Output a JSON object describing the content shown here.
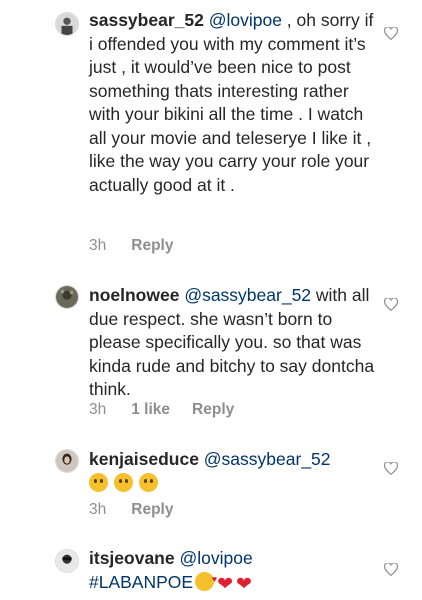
{
  "comments": [
    {
      "username": "sassybear_52",
      "mention": "@lovipoe",
      "text": " , oh sorry if i offended you with my comment it’s just , it would’ve been nice to post something thats interesting rather  with your bikini all the time . I watch all your movie and teleserye I like it , like the way you carry your role your actually good at it .",
      "time": "3h",
      "reply": "Reply"
    },
    {
      "username": "noelnowee",
      "mention": "@sassybear_52",
      "text": " with all due respect. she wasn’t born to please specifically you. so that was kinda rude and bitchy to say dontcha think.",
      "time": "3h",
      "likes": "1 like",
      "reply": "Reply"
    },
    {
      "username": "kenjaiseduce",
      "mention": "@sassybear_52",
      "emoji": "thinking-face x3",
      "time": "3h",
      "reply": "Reply"
    },
    {
      "username": "itsjeovane",
      "mention": "@lovipoe",
      "hashtag": "#LABANPOE",
      "emoji": "kiss-face, red-heart, red-heart"
    }
  ]
}
